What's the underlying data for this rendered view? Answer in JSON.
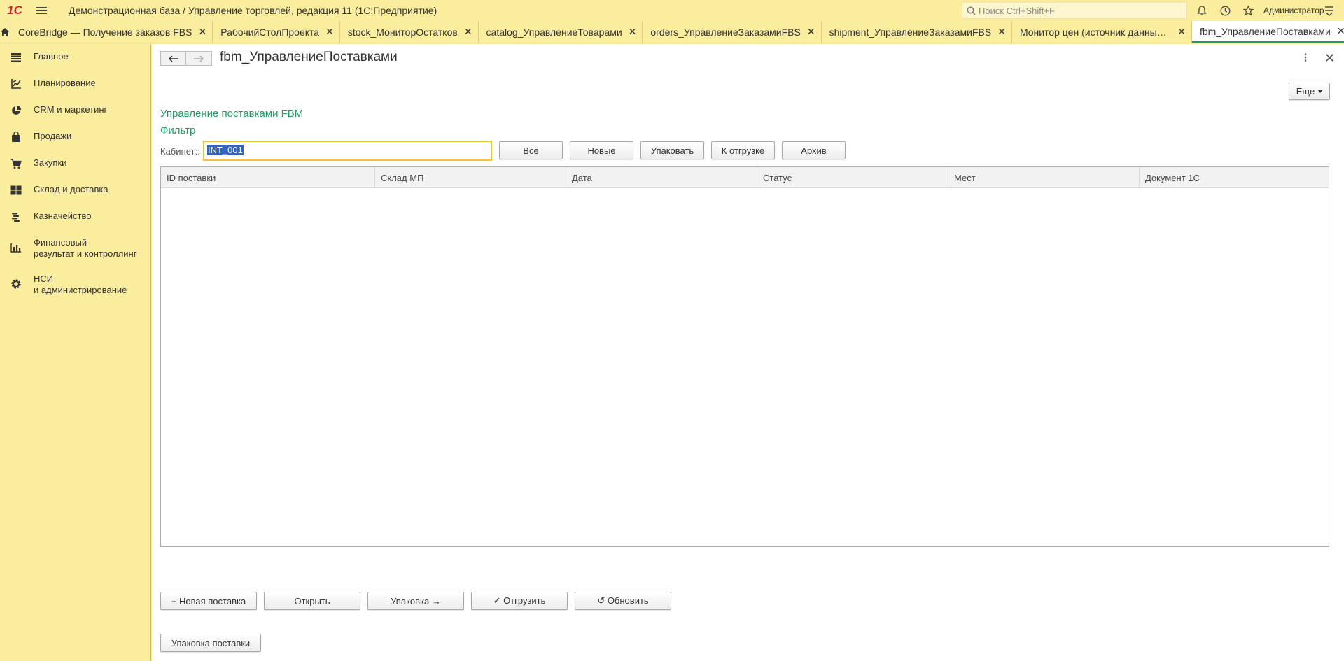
{
  "app": {
    "logo_text": "1С",
    "title": "Демонстрационная база / Управление торговлей, редакция 11  (1С:Предприятие)",
    "search_placeholder": "Поиск Ctrl+Shift+F",
    "user": "Администратор"
  },
  "tabs": [
    {
      "label": "CoreBridge — Получение заказов FBS",
      "active": false
    },
    {
      "label": "РабочийСтолПроекта",
      "active": false
    },
    {
      "label": "stock_МониторОстатков",
      "active": false
    },
    {
      "label": "catalog_УправлениеТоварами",
      "active": false
    },
    {
      "label": "orders_УправлениеЗаказамиFBS",
      "active": false
    },
    {
      "label": "shipment_УправлениеЗаказамиFBS",
      "active": false
    },
    {
      "label": "Монитор цен (источник данных недоступ...",
      "active": false
    },
    {
      "label": "fbm_УправлениеПоставками",
      "active": true
    }
  ],
  "sidebar": {
    "items": [
      {
        "label": "Главное",
        "icon": "list-icon"
      },
      {
        "label": "Планирование",
        "icon": "chart-line-icon"
      },
      {
        "label": "CRM и маркетинг",
        "icon": "pie-chart-icon"
      },
      {
        "label": "Продажи",
        "icon": "bag-icon"
      },
      {
        "label": "Закупки",
        "icon": "cart-icon"
      },
      {
        "label": "Склад и доставка",
        "icon": "grid-icon"
      },
      {
        "label": "Казначейство",
        "icon": "coins-icon"
      },
      {
        "label": "Финансовый\nрезультат и контроллинг",
        "icon": "bar-chart-icon"
      },
      {
        "label": "НСИ\nи администрирование",
        "icon": "gear-icon"
      }
    ]
  },
  "page": {
    "title": "fbm_УправлениеПоставками",
    "more_button": "Еще",
    "section_title": "Управление поставками FBM",
    "filter_title": "Фильтр",
    "cabinet_label": "Кабинет::",
    "cabinet_value": "INT_001",
    "filter_buttons": [
      "Все",
      "Новые",
      "Упаковать",
      "К отгрузке",
      "Архив"
    ],
    "columns": [
      "ID поставки",
      "Склад МП",
      "Дата",
      "Статус",
      "Мест",
      "Документ 1С"
    ],
    "actions": [
      "+ Новая поставка",
      "Открыть",
      "Упаковка →",
      "✓ Отгрузить",
      "↺ Обновить"
    ],
    "pack_button": "Упаковка поставки"
  },
  "colors": {
    "accent_green": "#1c9c63",
    "panel_yellow": "#fbed9e",
    "focus_yellow": "#f0c62c",
    "selection_blue": "#3264c8",
    "logo_red": "#d6222a"
  }
}
